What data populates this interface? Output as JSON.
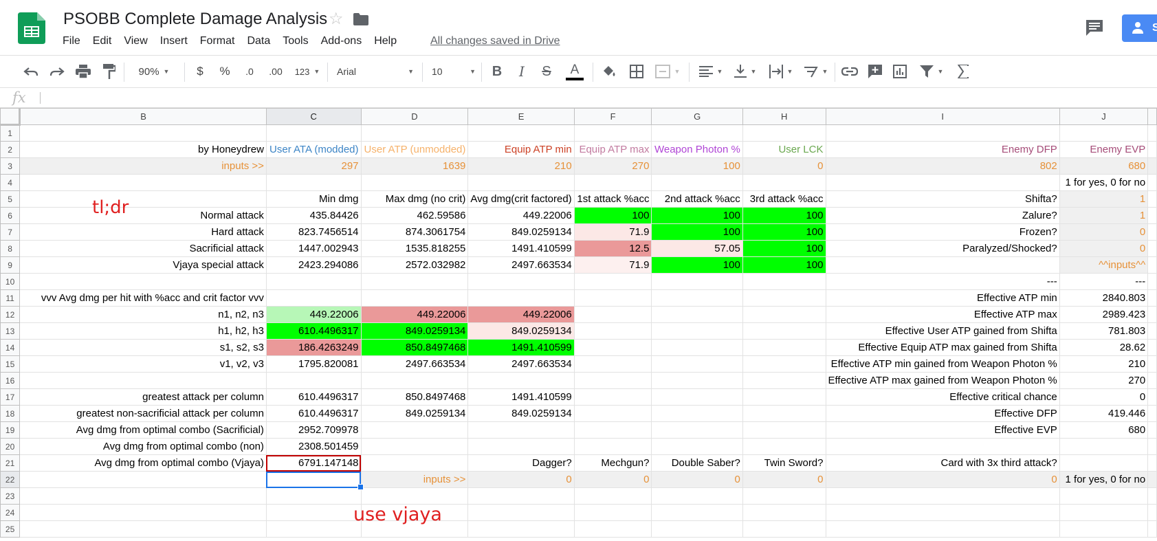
{
  "app": {
    "title": "PSOBB Complete Damage Analysis",
    "save_status": "All changes saved in Drive",
    "share_label": "Sh",
    "menu": [
      "File",
      "Edit",
      "View",
      "Insert",
      "Format",
      "Data",
      "Tools",
      "Add-ons",
      "Help"
    ]
  },
  "toolbar": {
    "zoom": "90%",
    "currency": "$",
    "percent": "%",
    "dec_decrease": ".0",
    "dec_increase": ".00",
    "more_formats": "123",
    "font": "Arial",
    "font_size": "10",
    "bold": "B",
    "italic": "I",
    "strike": "S",
    "text_color": "A"
  },
  "formula_bar": {
    "label": "fx",
    "value": ""
  },
  "grid": {
    "columns": [
      "B",
      "C",
      "D",
      "E",
      "F",
      "G",
      "H",
      "I",
      "J"
    ],
    "rows": [
      {
        "n": "1",
        "cells": [
          "",
          "",
          "",
          "",
          "",
          "",
          "",
          "",
          ""
        ]
      },
      {
        "n": "2",
        "cells": [
          "by Honeydrew",
          "User ATA (modded)",
          "User ATP (unmodded)",
          "Equip ATP min",
          "Equip ATP max",
          "Weapon Photon %",
          "User LCK",
          "Enemy DFP",
          "Enemy EVP"
        ]
      },
      {
        "n": "3",
        "cells": [
          "inputs >>",
          "297",
          "1639",
          "210",
          "270",
          "100",
          "0",
          "802",
          "680"
        ]
      },
      {
        "n": "4",
        "cells": [
          "",
          "",
          "",
          "",
          "",
          "",
          "",
          "",
          "1 for yes, 0 for no"
        ]
      },
      {
        "n": "5",
        "cells": [
          "",
          "Min dmg",
          "Max dmg (no crit)",
          "Avg dmg(crit factored)",
          "1st attack %acc",
          "2nd attack %acc",
          "3rd attack %acc",
          "Shifta?",
          "1"
        ]
      },
      {
        "n": "6",
        "cells": [
          "Normal attack",
          "435.84426",
          "462.59586",
          "449.22006",
          "100",
          "100",
          "100",
          "Zalure?",
          "1"
        ]
      },
      {
        "n": "7",
        "cells": [
          "Hard attack",
          "823.7456514",
          "874.3061754",
          "849.0259134",
          "71.9",
          "100",
          "100",
          "Frozen?",
          "0"
        ]
      },
      {
        "n": "8",
        "cells": [
          "Sacrificial attack",
          "1447.002943",
          "1535.818255",
          "1491.410599",
          "12.5",
          "57.05",
          "100",
          "Paralyzed/Shocked?",
          "0"
        ]
      },
      {
        "n": "9",
        "cells": [
          "Vjaya special attack",
          "2423.294086",
          "2572.032982",
          "2497.663534",
          "71.9",
          "100",
          "100",
          "",
          "^^inputs^^"
        ]
      },
      {
        "n": "10",
        "cells": [
          "",
          "",
          "",
          "",
          "",
          "",
          "",
          "---",
          "---"
        ]
      },
      {
        "n": "11",
        "cells": [
          "vvv Avg dmg per hit with %acc and crit factor vvv",
          "",
          "",
          "",
          "",
          "",
          "",
          "Effective ATP min",
          "2840.803"
        ]
      },
      {
        "n": "12",
        "cells": [
          "n1, n2, n3",
          "449.22006",
          "449.22006",
          "449.22006",
          "",
          "",
          "",
          "Effective ATP max",
          "2989.423"
        ]
      },
      {
        "n": "13",
        "cells": [
          "h1, h2, h3",
          "610.4496317",
          "849.0259134",
          "849.0259134",
          "",
          "",
          "",
          "Effective User ATP gained from Shifta",
          "781.803"
        ]
      },
      {
        "n": "14",
        "cells": [
          "s1, s2, s3",
          "186.4263249",
          "850.8497468",
          "1491.410599",
          "",
          "",
          "",
          "Effective Equip ATP max gained from Shifta",
          "28.62"
        ]
      },
      {
        "n": "15",
        "cells": [
          "v1, v2, v3",
          "1795.820081",
          "2497.663534",
          "2497.663534",
          "",
          "",
          "",
          "Effective ATP min gained from Weapon Photon %",
          "210"
        ]
      },
      {
        "n": "16",
        "cells": [
          "",
          "",
          "",
          "",
          "",
          "",
          "",
          "Effective ATP max gained from Weapon Photon %",
          "270"
        ]
      },
      {
        "n": "17",
        "cells": [
          "greatest attack per column",
          "610.4496317",
          "850.8497468",
          "1491.410599",
          "",
          "",
          "",
          "Effective critical chance",
          "0"
        ]
      },
      {
        "n": "18",
        "cells": [
          "greatest non-sacrificial attack per column",
          "610.4496317",
          "849.0259134",
          "849.0259134",
          "",
          "",
          "",
          "Effective DFP",
          "419.446"
        ]
      },
      {
        "n": "19",
        "cells": [
          "Avg dmg from optimal combo (Sacrificial)",
          "2952.709978",
          "",
          "",
          "",
          "",
          "",
          "Effective EVP",
          "680"
        ]
      },
      {
        "n": "20",
        "cells": [
          "Avg dmg from optimal combo (non)",
          "2308.501459",
          "",
          "",
          "",
          "",
          "",
          "",
          ""
        ]
      },
      {
        "n": "21",
        "cells": [
          "Avg dmg from optimal combo (Vjaya)",
          "6791.147148",
          "",
          "Dagger?",
          "Mechgun?",
          "Double Saber?",
          "Twin Sword?",
          "Card with 3x third attack?",
          ""
        ]
      },
      {
        "n": "22",
        "cells": [
          "",
          "",
          "inputs >>",
          "0",
          "0",
          "0",
          "0",
          "0",
          "1 for yes, 0 for no"
        ]
      },
      {
        "n": "23",
        "cells": [
          "",
          "",
          "",
          "",
          "",
          "",
          "",
          "",
          ""
        ]
      },
      {
        "n": "24",
        "cells": [
          "",
          "",
          "",
          "",
          "",
          "",
          "",
          "",
          ""
        ]
      },
      {
        "n": "25",
        "cells": [
          "",
          "",
          "",
          "",
          "",
          "",
          "",
          "",
          ""
        ]
      }
    ]
  },
  "annotations": {
    "tldr": "tl;dr",
    "use_vjaya": "use vjaya"
  }
}
